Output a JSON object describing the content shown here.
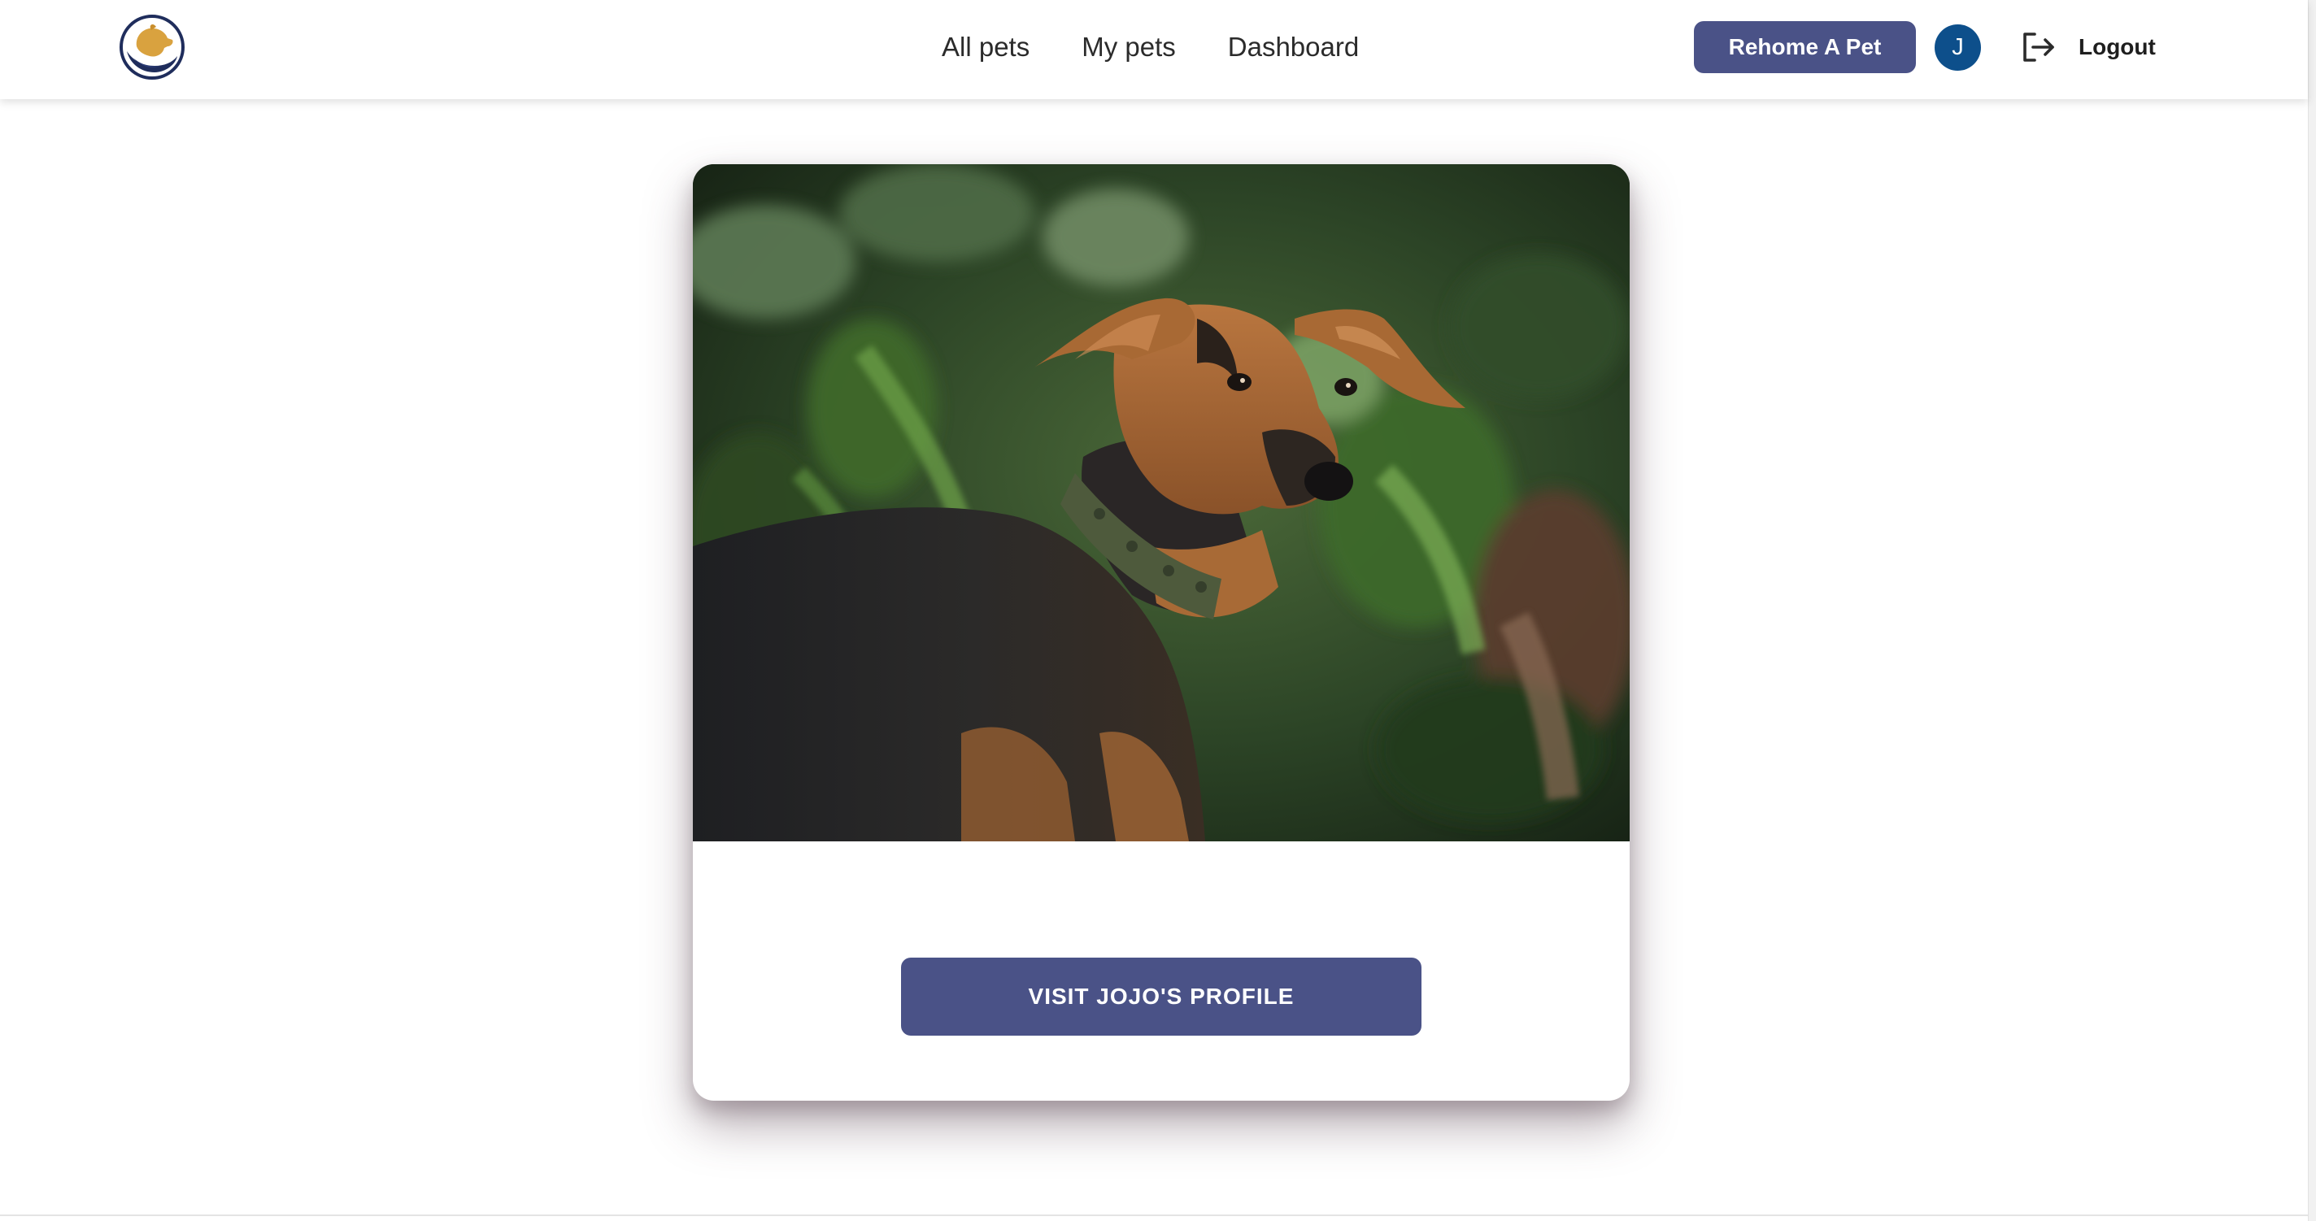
{
  "header": {
    "logo_icon": "pet-care-logo-icon",
    "nav": [
      {
        "label": "All pets"
      },
      {
        "label": "My pets"
      },
      {
        "label": "Dashboard"
      }
    ],
    "rehome_label": "Rehome A Pet",
    "avatar_initial": "J",
    "logout_icon": "logout-icon",
    "logout_label": "Logout"
  },
  "card": {
    "photo_alt": "photo",
    "button_label": "VISIT JOJO'S PROFILE"
  },
  "colors": {
    "primary": "#4a5287",
    "avatar": "#0d4f8b",
    "logo_gold": "#d9a23f",
    "logo_navy": "#1f2d5c"
  }
}
